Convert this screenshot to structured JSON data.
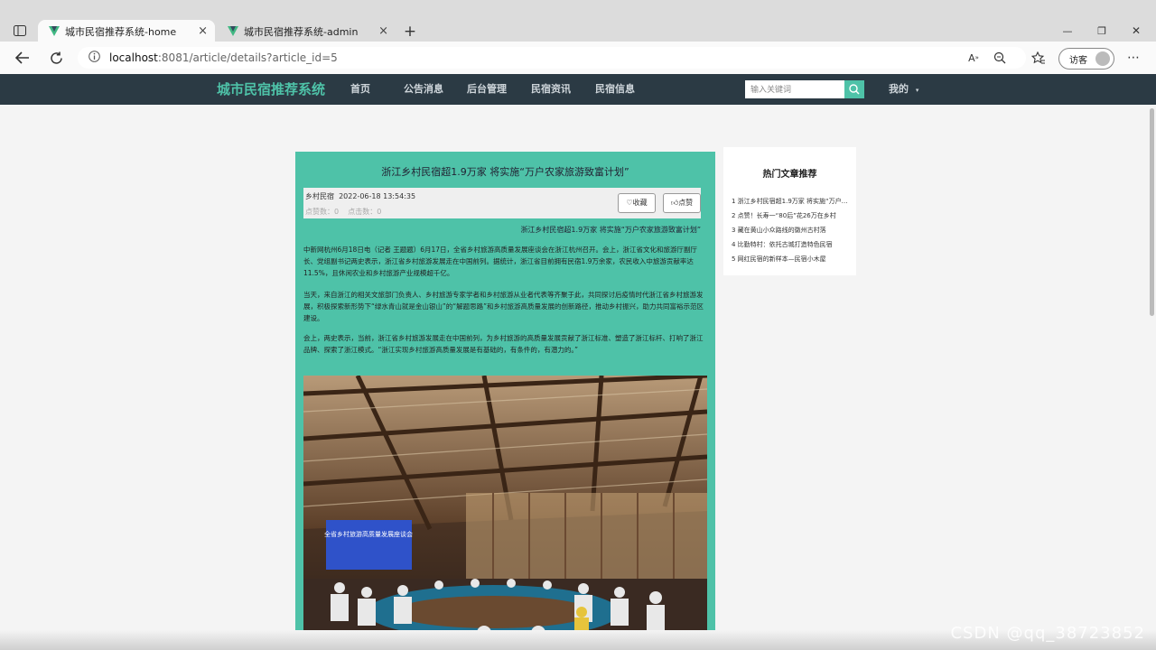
{
  "browser": {
    "tabs": [
      {
        "title": "城市民宿推荐系统-home",
        "close": "×"
      },
      {
        "title": "城市民宿推荐系统-admin",
        "close": "×"
      }
    ],
    "new_tab": "+",
    "url_host": "localhost",
    "url_rest": ":8081/article/details?article_id=5",
    "guest_label": "访客",
    "window_controls": [
      "—",
      "❐",
      "✕"
    ]
  },
  "site": {
    "brand": "城市民宿推荐系统",
    "nav": [
      "首页",
      "公告消息",
      "后台管理",
      "民宿资讯",
      "民宿信息"
    ],
    "search_placeholder": "输入关键词",
    "mine": "我的"
  },
  "article": {
    "title": "浙江乡村民宿超1.9万家 将实施“万户农家旅游致富计划”",
    "author": "乡村民宿",
    "datetime": "2022-06-18 13:54:35",
    "likes_label": "点赞数：",
    "likes": "0",
    "clicks_label": "点击数：",
    "clicks": "0",
    "collect_label": "收藏",
    "like_label": "点赞",
    "subtitle": "浙江乡村民宿超1.9万家 将实施“万户农家旅游致富计划”",
    "paragraphs": [
      "中新网杭州6月18日电（记者 王题题）6月17日，全省乡村旅游高质量发展座谈会在浙江杭州召开。会上，浙江省文化和旅游厅副厅长、党组副书记两史表示，浙江省乡村旅游发展走在中国前列。据统计，浙江省目前拥有民宿1.9万余家，农民收入中旅游贡献率达11.5%，且休闲农业和乡村旅游产业规模超千亿。",
      "当天，来自浙江的相关文旅部门负责人、乡村旅游专家学者和乡村旅游从业者代表等齐聚于此，共同探讨后疫情时代浙江省乡村旅游发展，积极探索新形势下“绿水青山就是金山银山”的“解题思路”和乡村旅游高质量发展的创新路径，推动乡村振兴，助力共同富裕示范区建设。",
      "会上，两史表示，当前，浙江省乡村旅游发展走在中国前列，为乡村旅游的高质量发展贡献了浙江标准、塑造了浙江标杆、打响了浙江品牌、探索了浙江模式。“浙江实现乡村旅游高质量发展是有基础的，有条件的，有潜力的。”"
    ],
    "photo_banner": "全省乡村旅游高质量发展座谈会"
  },
  "sidebar": {
    "title": "热门文章推荐",
    "items": [
      "1  浙江乡村民宿超1.9万家 将实施“万户农家旅游致富计划”",
      "2  点赞！长寿一“80后”花26万在乡村",
      "3  藏在黄山小众路线的徽州古村落",
      "4  比勤特村：依托古城打造特色民宿",
      "5  网红民宿的新样本—民宿小木屋"
    ]
  },
  "watermark": "CSDN @qq_38723852"
}
